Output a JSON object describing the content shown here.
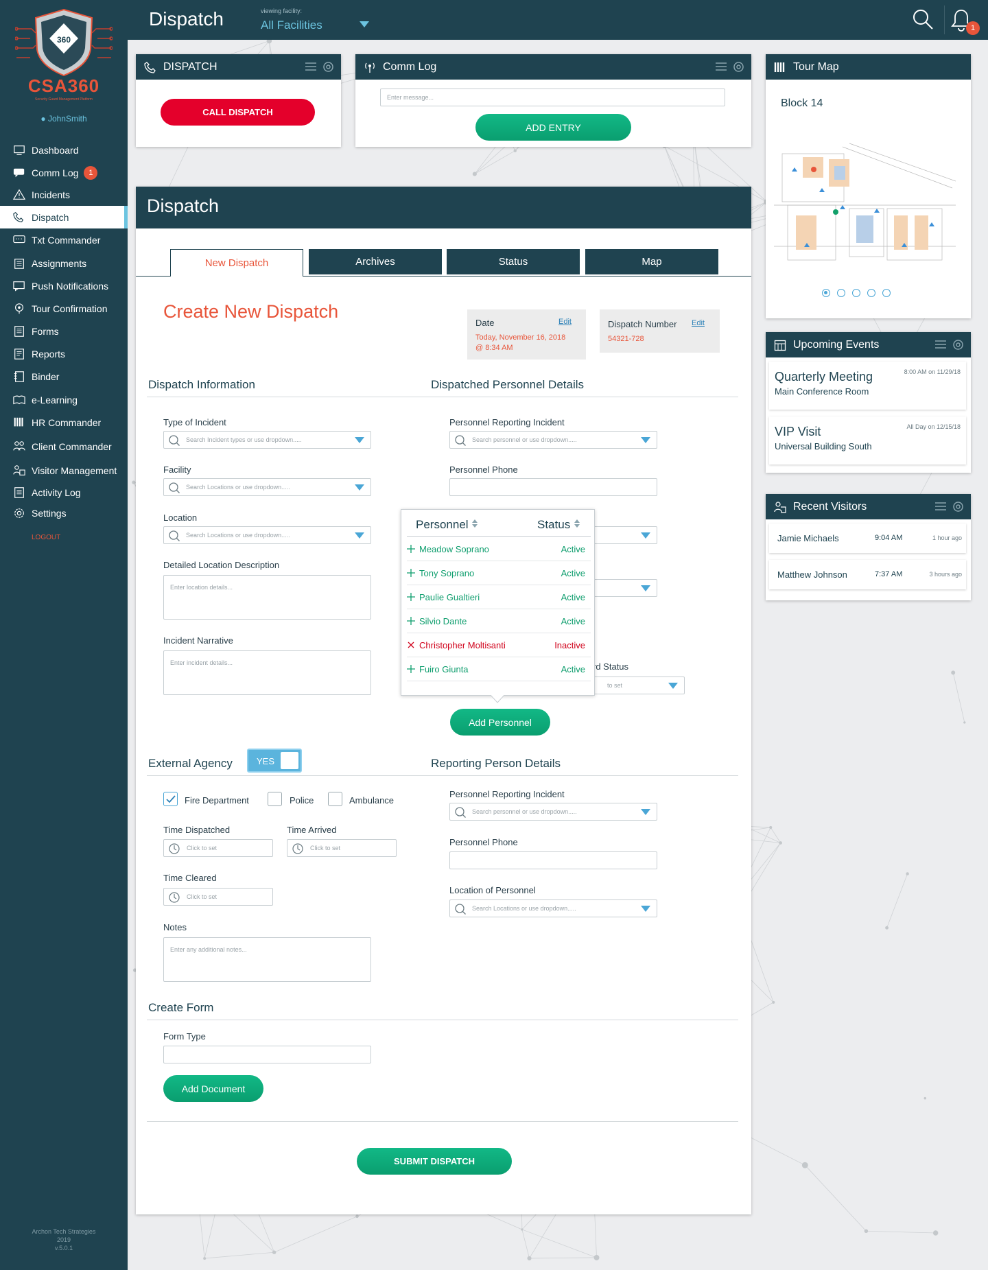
{
  "app": {
    "brand": "CSA360",
    "brand_tagline": "Security Guard Management Platform",
    "user": "JohnSmith",
    "logout": "LOGOUT",
    "footer": [
      "Archon Tech Strategies",
      "2019",
      "v.5.0.1"
    ]
  },
  "header": {
    "title": "Dispatch",
    "viewing_label": "viewing facility:",
    "facility": "All Facilities",
    "notifications": "1"
  },
  "sidebar": {
    "items": [
      {
        "label": "Dashboard",
        "icon": "dashboard-icon"
      },
      {
        "label": "Comm Log",
        "icon": "chat-icon",
        "badge": "1"
      },
      {
        "label": "Incidents",
        "icon": "warning-icon"
      },
      {
        "label": "Dispatch",
        "icon": "phone-icon",
        "active": true
      },
      {
        "label": "Txt Commander",
        "icon": "message-icon"
      },
      {
        "label": "Assignments",
        "icon": "clipboard-icon"
      },
      {
        "label": "Push Notifications",
        "icon": "push-icon"
      },
      {
        "label": "Tour Confirmation",
        "icon": "pin-icon"
      },
      {
        "label": "Forms",
        "icon": "form-icon"
      },
      {
        "label": "Reports",
        "icon": "report-icon"
      },
      {
        "label": "Binder",
        "icon": "binder-icon"
      },
      {
        "label": "e-Learning",
        "icon": "learning-icon"
      },
      {
        "label": "HR Commander",
        "icon": "hr-icon"
      },
      {
        "label": "Client Commander",
        "icon": "client-icon"
      },
      {
        "label": "Visitor Management",
        "icon": "visitor-icon"
      },
      {
        "label": "Activity Log",
        "icon": "activity-icon"
      },
      {
        "label": "Settings",
        "icon": "gear-icon"
      }
    ]
  },
  "dispatch_widget": {
    "title": "DISPATCH",
    "button": "CALL DISPATCH"
  },
  "commlog_widget": {
    "title": "Comm Log",
    "placeholder": "Enter message...",
    "button": "ADD  ENTRY"
  },
  "tourmap": {
    "title": "Tour Map",
    "map_title": "Block 14",
    "pages": 5,
    "active_page": 1
  },
  "events": {
    "title": "Upcoming Events",
    "items": [
      {
        "name": "Quarterly Meeting",
        "place": "Main Conference Room",
        "when": "8:00 AM on 11/29/18"
      },
      {
        "name": "VIP Visit",
        "place": "Universal Building South",
        "when": "All Day on 12/15/18"
      }
    ]
  },
  "visitors": {
    "title": "Recent Visitors",
    "items": [
      {
        "name": "Jamie Michaels",
        "time": "9:04 AM",
        "ago": "1 hour ago"
      },
      {
        "name": "Matthew Johnson",
        "time": "7:37 AM",
        "ago": "3 hours ago"
      }
    ]
  },
  "main": {
    "title": "Dispatch",
    "tabs": [
      "New Dispatch",
      "Archives",
      "Status",
      "Map"
    ],
    "heading": "Create New Dispatch",
    "date": {
      "label": "Date",
      "edit": "Edit",
      "value1": "Today, November 16, 2018",
      "value2": "@ 8:34 AM"
    },
    "dispatch_number": {
      "label": "Dispatch Number",
      "edit": "Edit",
      "value": "54321-728"
    },
    "dispatch_info": {
      "title": "Dispatch Information",
      "type_label": "Type of Incident",
      "type_ph": "Search Incident types or use dropdown.....",
      "facility_label": "Facility",
      "facility_ph": "Search Locations or use dropdown.....",
      "location_label": "Location",
      "location_ph": "Search Locations or use dropdown.....",
      "detail_label": "Detailed Location Description",
      "detail_ph": "Enter location details...",
      "narrative_label": "Incident Narrative",
      "narrative_ph": "Enter incident details..."
    },
    "personnel": {
      "title": "Dispatched Personnel Details",
      "reporting_label": "Personnel Reporting Incident",
      "reporting_ph": "Search personnel or use dropdown.....",
      "phone_label": "Personnel Phone",
      "status_label_partial": "rd Status",
      "status_ph_partial": "to set",
      "add_button": "Add Personnel"
    },
    "popup": {
      "col_personnel": "Personnel",
      "col_status": "Status",
      "rows": [
        {
          "name": "Meadow Soprano",
          "status": "Active",
          "kind": "add"
        },
        {
          "name": "Tony Soprano",
          "status": "Active",
          "kind": "add"
        },
        {
          "name": "Paulie Gualtieri",
          "status": "Active",
          "kind": "add"
        },
        {
          "name": "Silvio Dante",
          "status": "Active",
          "kind": "add"
        },
        {
          "name": "Christopher Moltisanti",
          "status": "Inactive",
          "kind": "remove"
        },
        {
          "name": "Fuiro Giunta",
          "status": "Active",
          "kind": "add"
        }
      ]
    },
    "external": {
      "title": "External Agency",
      "toggle": "YES",
      "fire": "Fire Department",
      "fire_checked": true,
      "police": "Police",
      "ambulance": "Ambulance",
      "dispatched_label": "Time Dispatched",
      "arrived_label": "Time Arrived",
      "cleared_label": "Time Cleared",
      "time_ph": "Click to set",
      "notes_label": "Notes",
      "notes_ph": "Enter any additional notes..."
    },
    "reporting": {
      "title": "Reporting Person Details",
      "reporting_label": "Personnel Reporting Incident",
      "reporting_ph": "Search personnel or use dropdown.....",
      "phone_label": "Personnel Phone",
      "location_label": "Location of Personnel",
      "location_ph": "Search Locations or use dropdown....."
    },
    "form": {
      "title": "Create Form",
      "type_label": "Form Type",
      "add_doc": "Add Document"
    },
    "submit": "SUBMIT DISPATCH"
  },
  "colors": {
    "navy": "#1f4350",
    "accent": "#e8553a",
    "green": "#12b886",
    "red": "#e4002b",
    "sky": "#6cc4e0"
  }
}
